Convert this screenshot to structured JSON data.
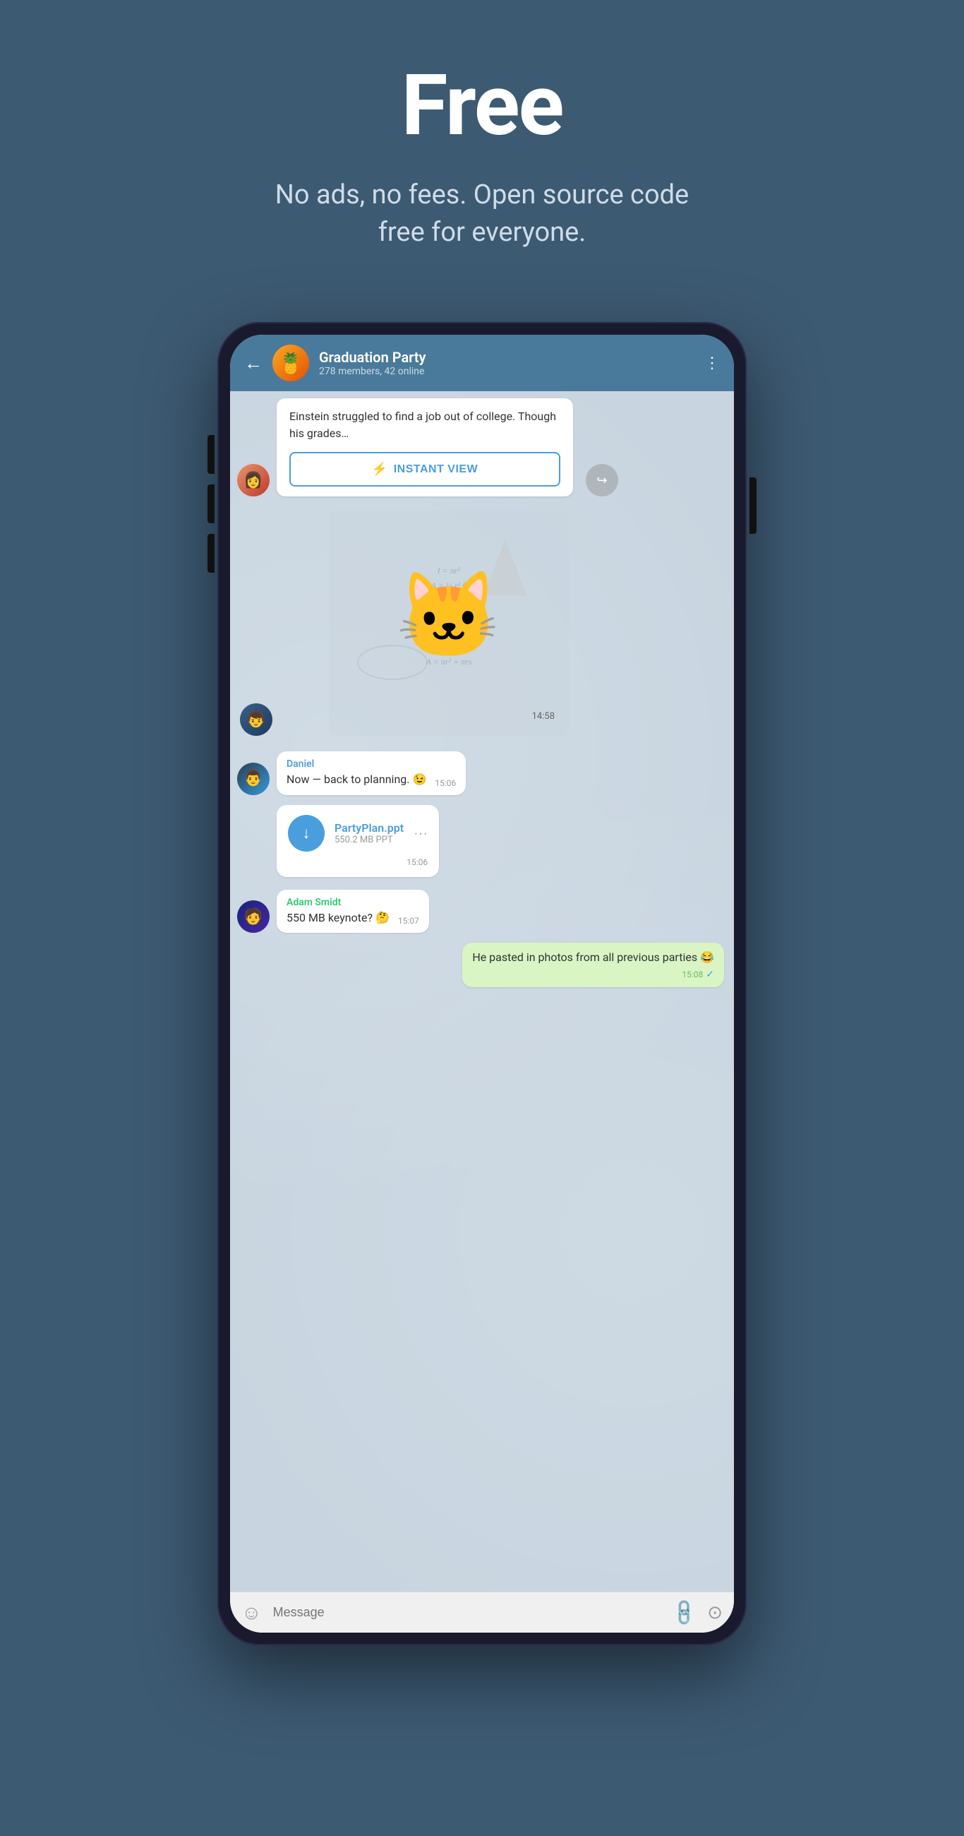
{
  "hero": {
    "title": "Free",
    "subtitle": "No ads, no fees. Open source code free for everyone."
  },
  "chat": {
    "header": {
      "group_name": "Graduation Party",
      "group_meta": "278 members, 42 online",
      "back_label": "←",
      "more_label": "⋮"
    },
    "article": {
      "text": "Einstein struggled to find a job out of college. Though his grades…",
      "instant_view_label": "INSTANT VIEW",
      "instant_view_icon": "⚡"
    },
    "sticker": {
      "time": "14:58"
    },
    "messages": [
      {
        "id": "msg1",
        "sender": "Daniel",
        "sender_color": "blue",
        "text": "Now — back to planning. 😉",
        "time": "15:06",
        "outgoing": false
      },
      {
        "id": "msg2",
        "file_name": "PartyPlan.ppt",
        "file_meta": "550.2 MB PPT",
        "time": "15:06",
        "outgoing": false
      },
      {
        "id": "msg3",
        "sender": "Adam Smidt",
        "sender_color": "green",
        "text": "550 MB keynote? 🤔",
        "time": "15:07",
        "outgoing": false
      },
      {
        "id": "msg4",
        "text": "He pasted in photos from all previous parties 😂",
        "time": "15:08",
        "outgoing": true,
        "checkmark": "✓"
      }
    ],
    "input": {
      "placeholder": "Message",
      "emoji_icon": "☺",
      "attach_icon": "📎",
      "camera_icon": "⊙"
    }
  }
}
